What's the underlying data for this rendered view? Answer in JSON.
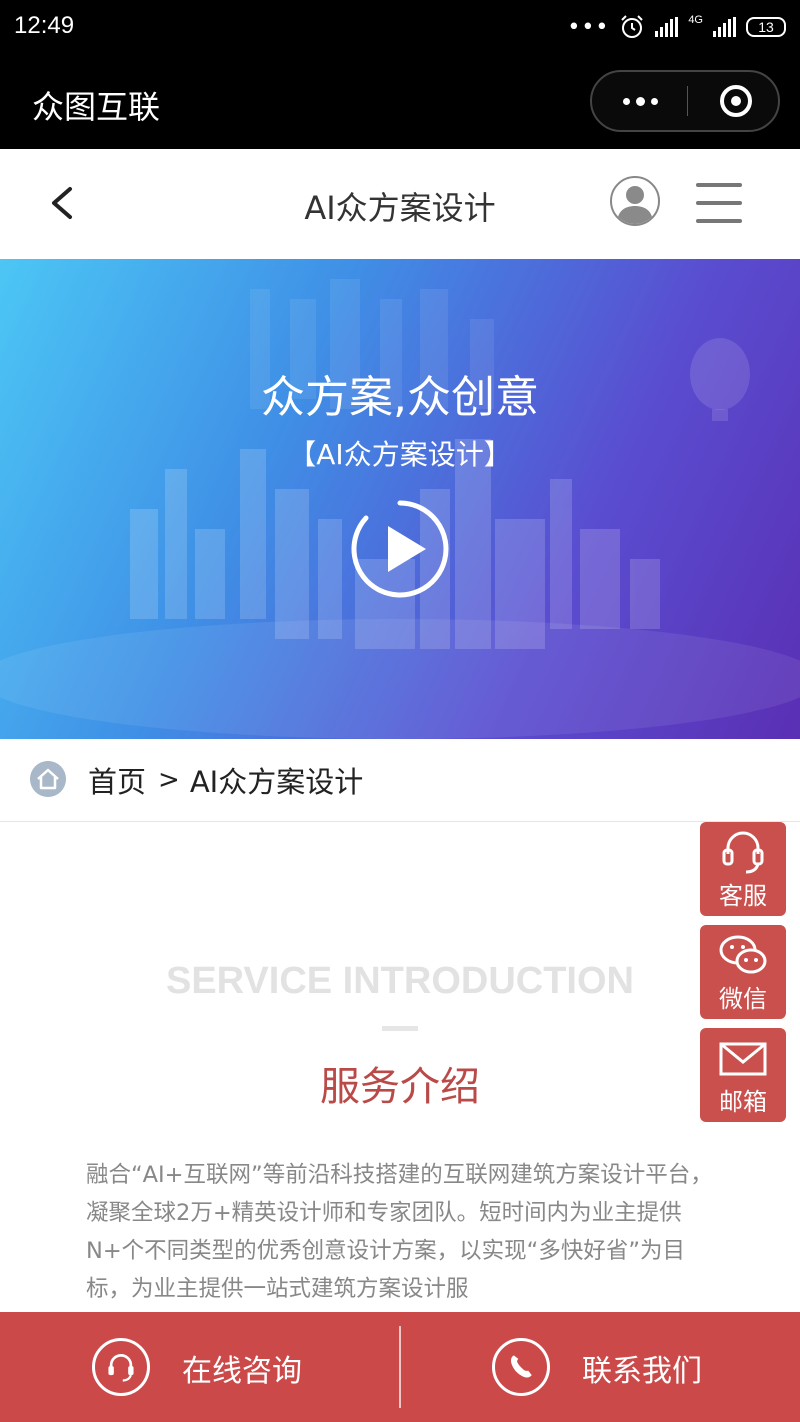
{
  "status_bar": {
    "time": "12:49",
    "battery": "13",
    "network": "4G"
  },
  "mini_program": {
    "title": "众图互联"
  },
  "nav": {
    "title": "AI众方案设计"
  },
  "banner": {
    "headline": "众方案,众创意",
    "subheadline": "【AI众方案设计】"
  },
  "breadcrumb": {
    "home": "首页",
    "separator": ">",
    "current": "AI众方案设计"
  },
  "intro": {
    "title_en": "SERVICE INTRODUCTION",
    "title_cn": "服务介绍",
    "body": "融合“AI+互联网”等前沿科技搭建的互联网建筑方案设计平台，凝聚全球2万+精英设计师和专家团队。短时间内为业主提供N+个不同类型的优秀创意设计方案，以实现“多快好省”为目标，为业主提供一站式建筑方案设计服"
  },
  "side_buttons": [
    {
      "label": "客服",
      "icon": "headset-icon"
    },
    {
      "label": "微信",
      "icon": "wechat-icon"
    },
    {
      "label": "邮箱",
      "icon": "mail-icon"
    }
  ],
  "bottom_bar": {
    "consult_label": "在线咨询",
    "contact_label": "联系我们"
  },
  "colors": {
    "accent": "#c9504d",
    "bottom_bar": "#cb4a49",
    "title_red": "#b94a48"
  }
}
